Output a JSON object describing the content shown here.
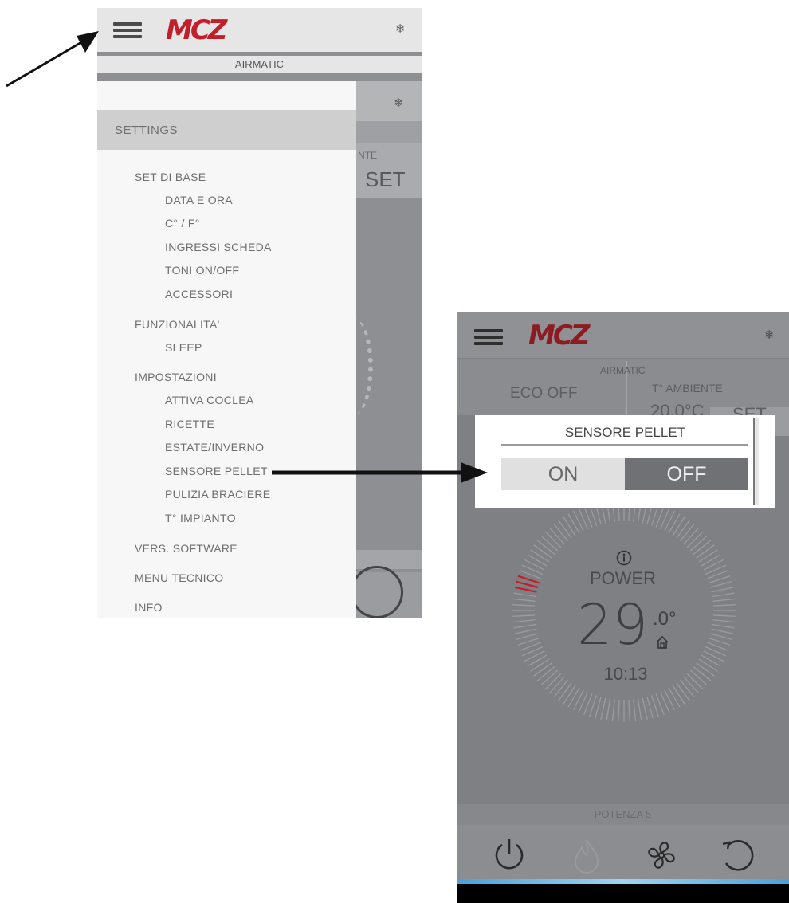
{
  "left_phone": {
    "brand": "MCZ",
    "mode_icon": "snowflake-icon",
    "mode_label": "AIRMATIC",
    "background_fragments": {
      "ambient": "NTE",
      "set": "SET"
    },
    "menu": {
      "title": "SETTINGS",
      "groups": [
        {
          "label": "SET DI BASE",
          "items": [
            "DATA E ORA",
            "C° / F°",
            "INGRESSI SCHEDA",
            "TONI ON/OFF",
            "ACCESSORI"
          ]
        },
        {
          "label": "FUNZIONALITA'",
          "items": [
            "SLEEP"
          ]
        },
        {
          "label": "IMPOSTAZIONI",
          "items": [
            "ATTIVA COCLEA",
            "RICETTE",
            "ESTATE/INVERNO",
            "SENSORE PELLET",
            "PULIZIA BRACIERE",
            "T° IMPIANTO"
          ]
        },
        {
          "label": "VERS. SOFTWARE",
          "items": []
        },
        {
          "label": "MENU TECNICO",
          "items": []
        },
        {
          "label": "INFO",
          "items": []
        }
      ]
    }
  },
  "right_phone": {
    "brand": "MCZ",
    "mode_label": "AIRMATIC",
    "eco_label": "ECO OFF",
    "ambient_label": "T° AMBIENTE",
    "ambient_temp": "20.0°C",
    "set_label": "SET",
    "popup": {
      "title": "SENSORE PELLET",
      "on_label": "ON",
      "off_label": "OFF",
      "selected": "OFF"
    },
    "dial": {
      "info_icon": "info-icon",
      "status": "POWER",
      "temp_int": "29",
      "temp_dec": ".0°",
      "home_icon": "home-icon",
      "time": "10:13"
    },
    "power_level": "POTENZA 5",
    "bottom_icons": [
      "power-icon",
      "flame-icon",
      "fan-icon",
      "refresh-icon"
    ],
    "accent": "#c41e2a"
  }
}
